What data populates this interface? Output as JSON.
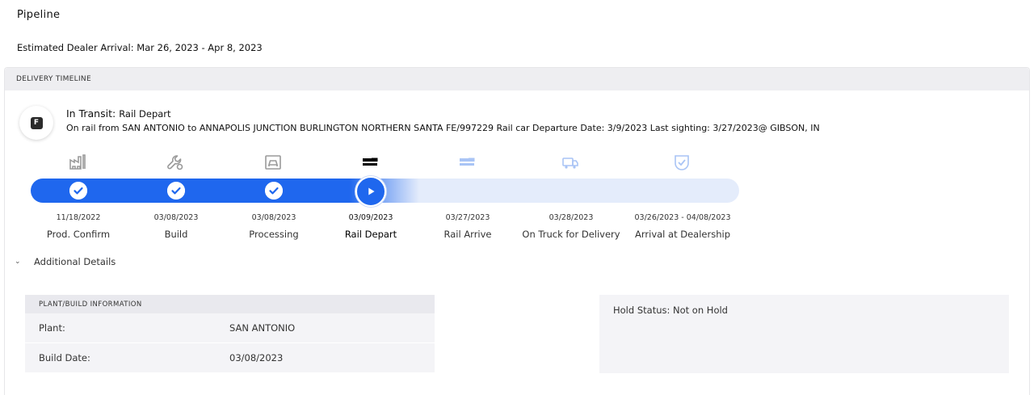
{
  "page": {
    "title": "Pipeline",
    "eta": "Estimated Dealer Arrival: Mar 26, 2023 - Apr 8, 2023"
  },
  "timeline": {
    "header": "DELIVERY TIMELINE",
    "badge_letter": "F",
    "status_title": "In Transit:",
    "status_subtitle": "Rail Depart",
    "status_description": "On rail from SAN ANTONIO to ANNAPOLIS JUNCTION BURLINGTON NORTHERN SANTA FE/997229 Rail car Departure Date: 3/9/2023 Last sighting: 3/27/2023@ GIBSON, IN",
    "progress_fraction": 0.52,
    "colors": {
      "accent": "#1f67ee",
      "track": "#e4ecfb",
      "icon_done": "#9a9a9a",
      "icon_current": "#000000",
      "icon_upcoming": "#a9c4f5"
    },
    "stages": [
      {
        "label": "Prod. Confirm",
        "date": "11/18/2022",
        "state": "done",
        "icon": "factory-icon"
      },
      {
        "label": "Build",
        "date": "03/08/2023",
        "state": "done",
        "icon": "wrench-icon"
      },
      {
        "label": "Processing",
        "date": "03/08/2023",
        "state": "done",
        "icon": "vehicle-processing-icon"
      },
      {
        "label": "Rail Depart",
        "date": "03/09/2023",
        "state": "current",
        "icon": "rail-car-icon"
      },
      {
        "label": "Rail Arrive",
        "date": "03/27/2023",
        "state": "upcoming",
        "icon": "rail-car-icon"
      },
      {
        "label": "On Truck for Delivery",
        "date": "03/28/2023",
        "state": "upcoming",
        "icon": "truck-icon"
      },
      {
        "label": "Arrival at Dealership",
        "date": "03/26/2023 - 04/08/2023",
        "state": "upcoming",
        "icon": "shield-check-icon"
      }
    ]
  },
  "details": {
    "toggle_label": "Additional Details",
    "plant_panel": {
      "header": "PLANT/BUILD INFORMATION",
      "rows": [
        {
          "key": "Plant:",
          "value": "SAN ANTONIO"
        },
        {
          "key": "Build Date:",
          "value": "03/08/2023"
        }
      ]
    },
    "hold_status": "Hold Status: Not on Hold"
  }
}
